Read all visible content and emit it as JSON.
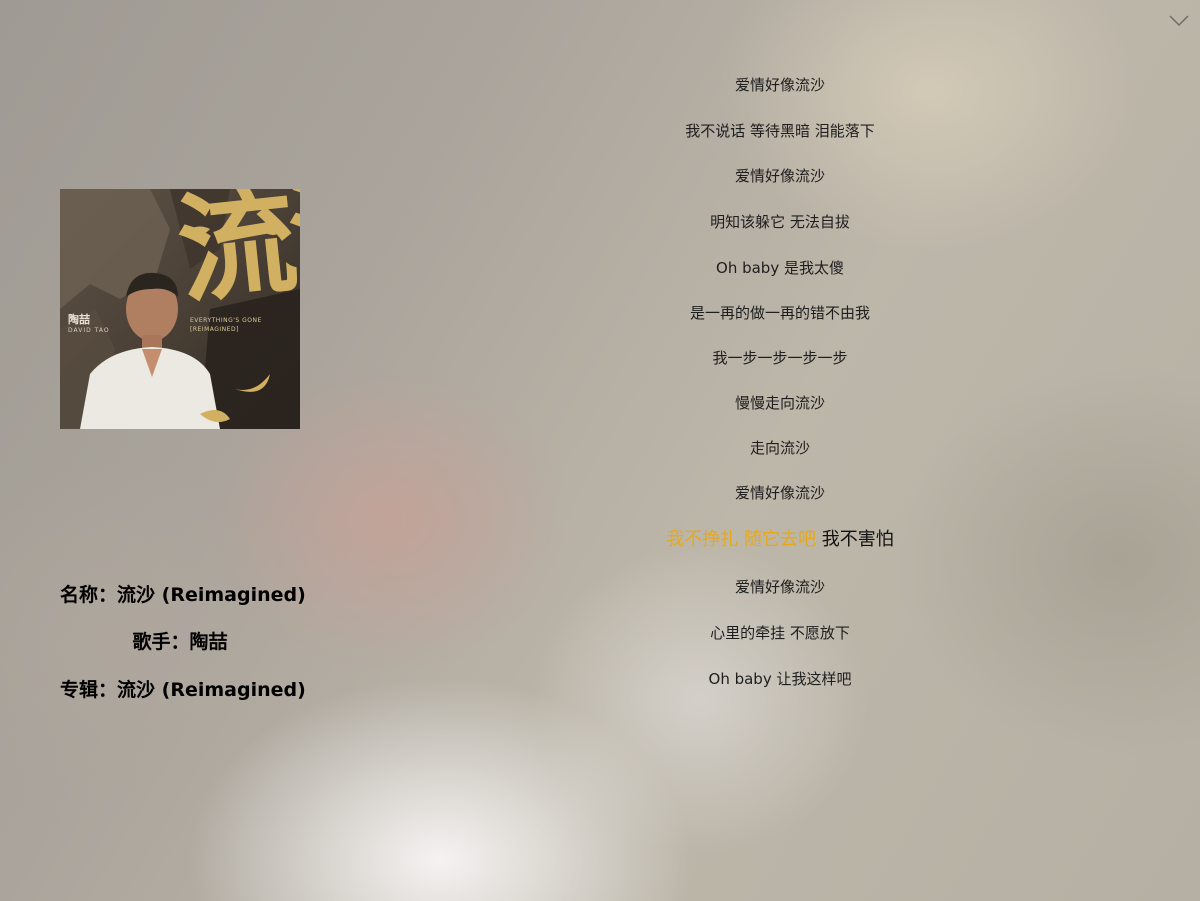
{
  "window": {
    "close_icon": "chevron-down-icon"
  },
  "cover": {
    "artist_cn": "陶喆",
    "artist_en": "DAVID TAO",
    "calligraphy": "流沙",
    "subtitle_line1": "EVERYTHING'S GONE",
    "subtitle_line2": "[REIMAGINED]",
    "accent_color": "#d2b061"
  },
  "song_info": {
    "name_label": "名称：",
    "name_value": "流沙 (Reimagined)",
    "singer_label": "歌手：",
    "singer_value": "陶喆",
    "album_label": "专辑：",
    "album_value": "流沙 (Reimagined)"
  },
  "lyrics": {
    "highlight_color": "#e8a817",
    "lines": [
      "爱情好像流沙",
      "我不说话 等待黑暗 泪能落下",
      "爱情好像流沙",
      "明知该躲它 无法自拔",
      "Oh baby 是我太傻",
      "是一再的做一再的错不由我",
      "我一步一步一步一步",
      "慢慢走向流沙",
      "走向流沙",
      "爱情好像流沙"
    ],
    "current_line_sung": "我不挣扎 随它去吧",
    "current_line_rest": " 我不害怕",
    "after_lines": [
      "爱情好像流沙",
      "心里的牵挂 不愿放下",
      "Oh baby 让我这样吧"
    ]
  }
}
